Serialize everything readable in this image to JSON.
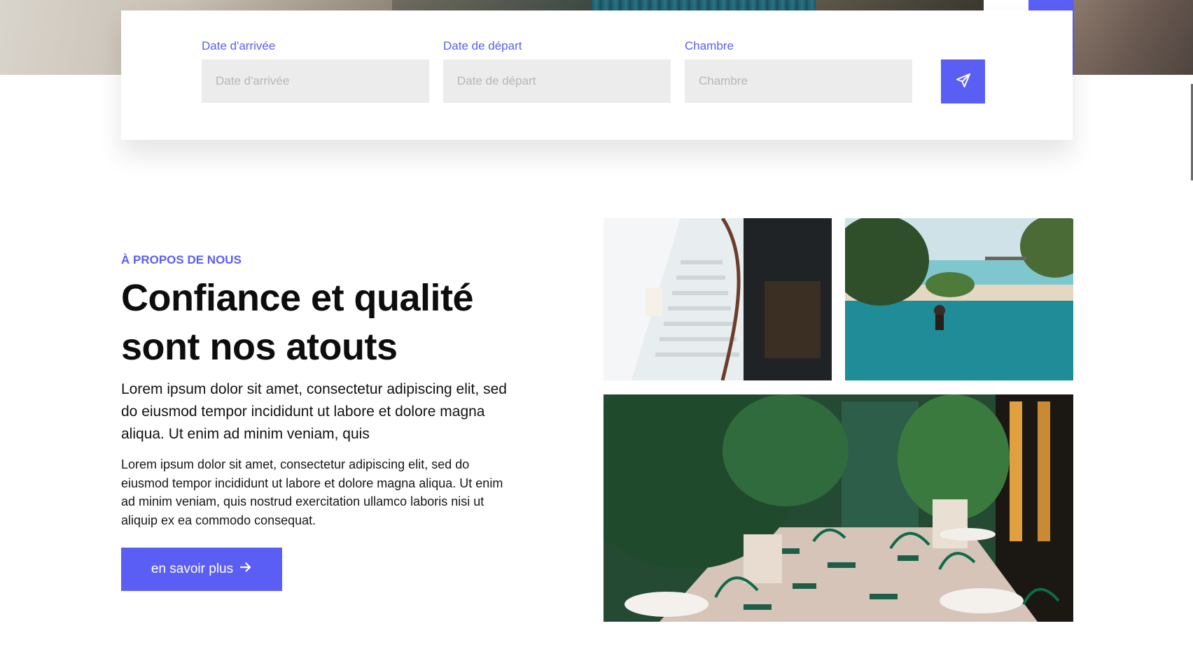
{
  "booking": {
    "arrival": {
      "label": "Date d'arrivée",
      "placeholder": "Date d'arrivée"
    },
    "departure": {
      "label": "Date de départ",
      "placeholder": "Date de départ"
    },
    "room": {
      "label": "Chambre",
      "placeholder": "Chambre"
    },
    "submit_icon": "send-icon"
  },
  "about": {
    "eyebrow": "À PROPOS DE NOUS",
    "headline_line1": "Confiance et qualité",
    "headline_line2": "sont nos atouts",
    "lead": "Lorem ipsum dolor sit amet, consectetur adipiscing elit, sed do eiusmod tempor incididunt ut labore et dolore magna aliqua. Ut enim ad minim veniam, quis",
    "body": "Lorem ipsum dolor sit amet, consectetur adipiscing elit, sed do eiusmod tempor incididunt ut labore et dolore magna aliqua. Ut enim ad minim veniam, quis nostrud exercitation ullamco laboris nisi ut aliquip ex ea commodo consequat.",
    "cta_label": "en savoir plus",
    "cta_icon": "arrow-right-icon"
  },
  "gallery": {
    "images": [
      "staircase-photo",
      "infinity-pool-photo",
      "garden-terrace-photo"
    ]
  },
  "colors": {
    "accent": "#5b5ef5",
    "input_bg": "#ececec",
    "text": "#0d0d0d"
  }
}
